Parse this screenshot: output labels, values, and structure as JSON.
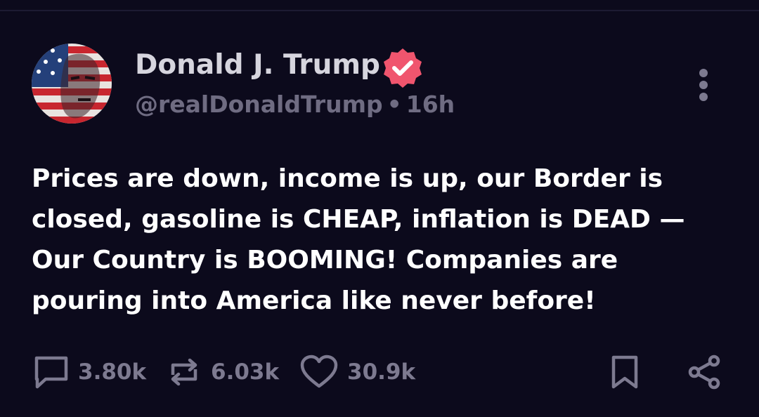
{
  "post": {
    "author": {
      "display_name": "Donald J. Trump",
      "handle": "@realDonaldTrump",
      "separator": "•",
      "time_ago": "16h",
      "verified": true,
      "avatar": "avatar-flag-portrait"
    },
    "text": "Prices are down, income is up, our Border is closed, gasoline is CHEAP, inflation is DEAD — Our Country is BOOMING! Companies are pouring into America like never before!",
    "actions": {
      "replies": "3.80k",
      "reposts": "6.03k",
      "likes": "30.9k"
    },
    "icons": {
      "reply": "reply-icon",
      "repost": "repost-icon",
      "like": "heart-icon",
      "bookmark": "bookmark-icon",
      "share": "share-icon",
      "more": "more-vertical-icon",
      "verified": "verified-badge-icon"
    }
  },
  "colors": {
    "background": "#0c0a1c",
    "display_name": "#d6d5de",
    "muted_text": "#6f6c82",
    "verified_badge": "#f0556e",
    "icon_gray": "#7d7a90"
  }
}
